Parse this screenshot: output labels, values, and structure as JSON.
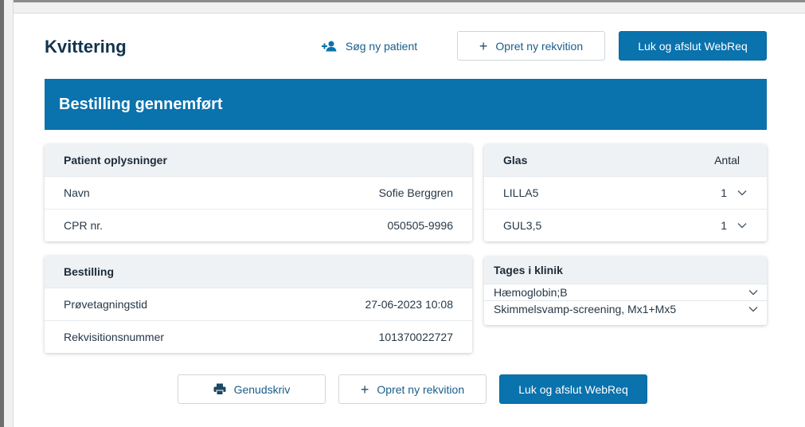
{
  "header": {
    "title": "Kvittering",
    "search_patient": "Søg ny patient",
    "new_requisition": "Opret ny rekvition",
    "close_webreq": "Luk og afslut WebReq"
  },
  "banner": {
    "text": "Bestilling gennemført"
  },
  "patient": {
    "heading": "Patient oplysninger",
    "rows": [
      {
        "label": "Navn",
        "value": "Sofie Berggren"
      },
      {
        "label": "CPR nr.",
        "value": "050505-9996"
      }
    ]
  },
  "order": {
    "heading": "Bestilling",
    "rows": [
      {
        "label": "Prøvetagningstid",
        "value": "27-06-2023 10:08"
      },
      {
        "label": "Rekvisitionsnummer",
        "value": "101370022727"
      }
    ]
  },
  "glas": {
    "heading": "Glas",
    "count_heading": "Antal",
    "rows": [
      {
        "name": "LILLA5",
        "count": "1"
      },
      {
        "name": "GUL3,5",
        "count": "1"
      }
    ]
  },
  "clinic": {
    "heading": "Tages i klinik",
    "items": [
      {
        "label": "Hæmoglobin;B"
      },
      {
        "label": "Skimmelsvamp-screening, Mx1+Mx5"
      }
    ]
  },
  "footer": {
    "reprint": "Genudskriv",
    "new_requisition": "Opret ny rekvition",
    "close_webreq": "Luk og afslut WebReq"
  },
  "colors": {
    "primary": "#0a72ad",
    "title": "#10344f",
    "card_header": "#eff2f5"
  }
}
